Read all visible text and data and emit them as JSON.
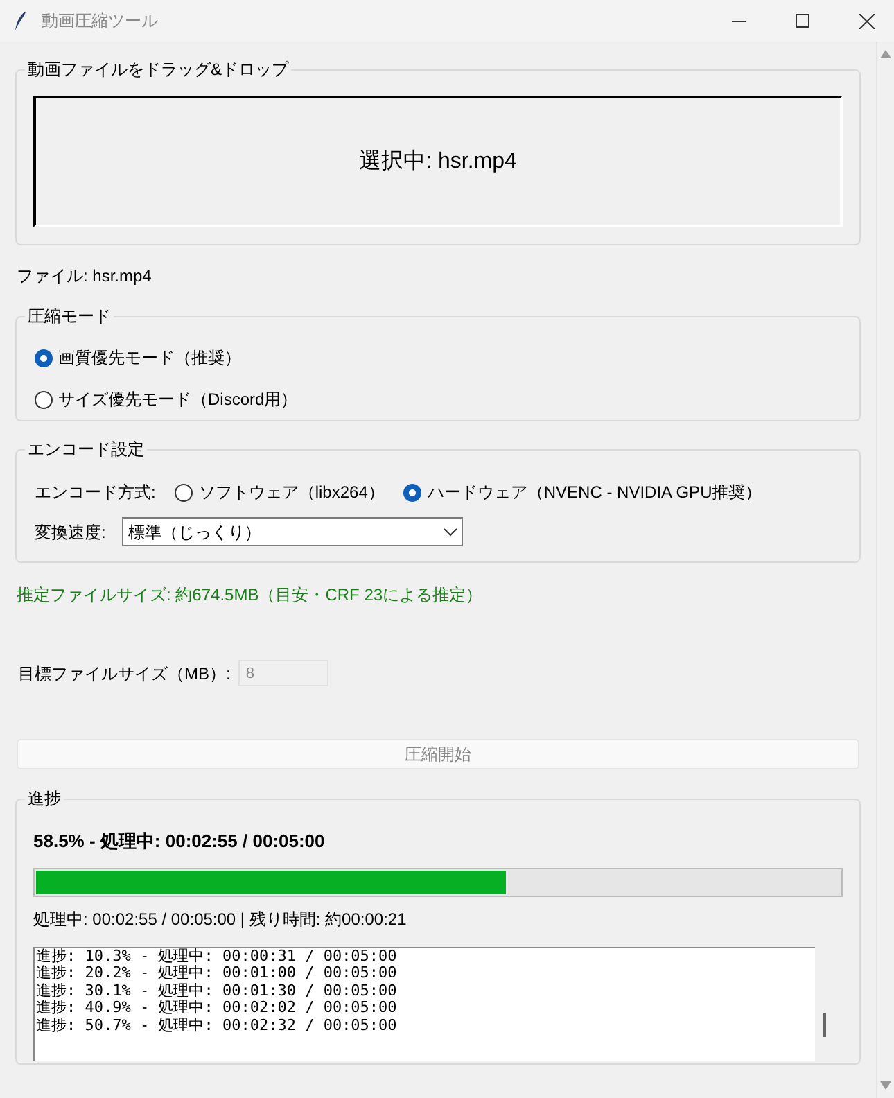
{
  "window": {
    "title": "動画圧縮ツール"
  },
  "drop_zone": {
    "label": "動画ファイルをドラッグ&ドロップ",
    "text": "選択中: hsr.mp4"
  },
  "file_label": "ファイル: hsr.mp4",
  "compression_mode": {
    "label": "圧縮モード",
    "options": [
      {
        "label": "画質優先モード（推奨）",
        "selected": true
      },
      {
        "label": "サイズ優先モード（Discord用）",
        "selected": false
      }
    ]
  },
  "encode_settings": {
    "label": "エンコード設定",
    "method_label": "エンコード方式:",
    "methods": [
      {
        "label": "ソフトウェア（libx264）",
        "selected": false
      },
      {
        "label": "ハードウェア（NVENC - NVIDIA GPU推奨）",
        "selected": true
      }
    ],
    "speed_label": "変換速度:",
    "speed_value": "標準（じっくり）"
  },
  "estimate": "推定ファイルサイズ: 約674.5MB（目安・CRF 23による推定）",
  "target_size": {
    "label": "目標ファイルサイズ（MB）:",
    "value": "8",
    "disabled": true
  },
  "start_button": {
    "label": "圧縮開始",
    "disabled": true
  },
  "progress": {
    "label": "進捗",
    "headline": "58.5% - 処理中: 00:02:55 / 00:05:00",
    "level": 0.585,
    "detail": "処理中: 00:02:55 / 00:05:00 | 残り時間: 約00:00:21",
    "log": [
      "進捗: 10.3% - 処理中: 00:00:31 / 00:05:00",
      "進捗: 20.2% - 処理中: 00:01:00 / 00:05:00",
      "進捗: 30.1% - 処理中: 00:01:30 / 00:05:00",
      "進捗: 40.9% - 処理中: 00:02:02 / 00:05:00",
      "進捗: 50.7% - 処理中: 00:02:32 / 00:05:00"
    ]
  }
}
